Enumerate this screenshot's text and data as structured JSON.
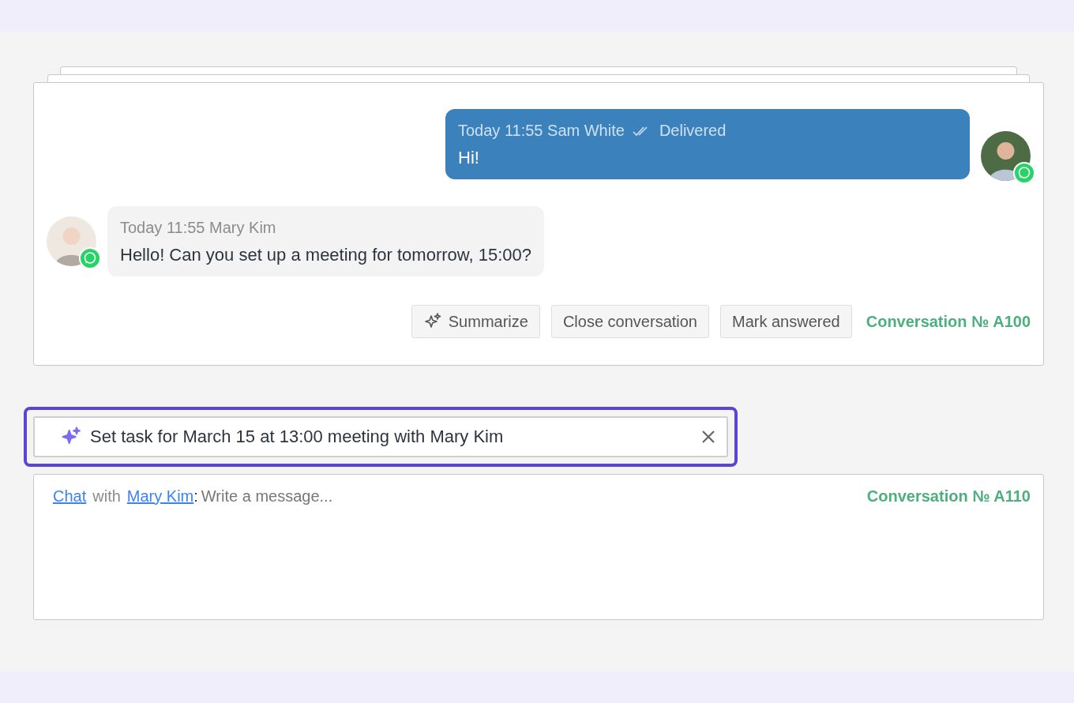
{
  "conversation": {
    "messages": [
      {
        "kind": "outgoing",
        "time": "Today 11:55",
        "author": "Sam White",
        "status": "Delivered",
        "text": "Hi!"
      },
      {
        "kind": "incoming",
        "time": "Today 11:55",
        "author": "Mary Kim",
        "text": "Hello! Can you set up a meeting for tomorrow, 15:00?"
      }
    ],
    "actions": [
      "Summarize",
      "Close conversation",
      "Mark answered"
    ],
    "number": "Conversation № A100"
  },
  "suggestion": {
    "text": "Set task for March 15 at 13:00 meeting with Mary Kim"
  },
  "composer": {
    "chat_link": "Chat",
    "connector": "with",
    "contact_link": "Mary Kim",
    "separator": ":",
    "placeholder": "Write a message...",
    "number": "Conversation № A110"
  }
}
